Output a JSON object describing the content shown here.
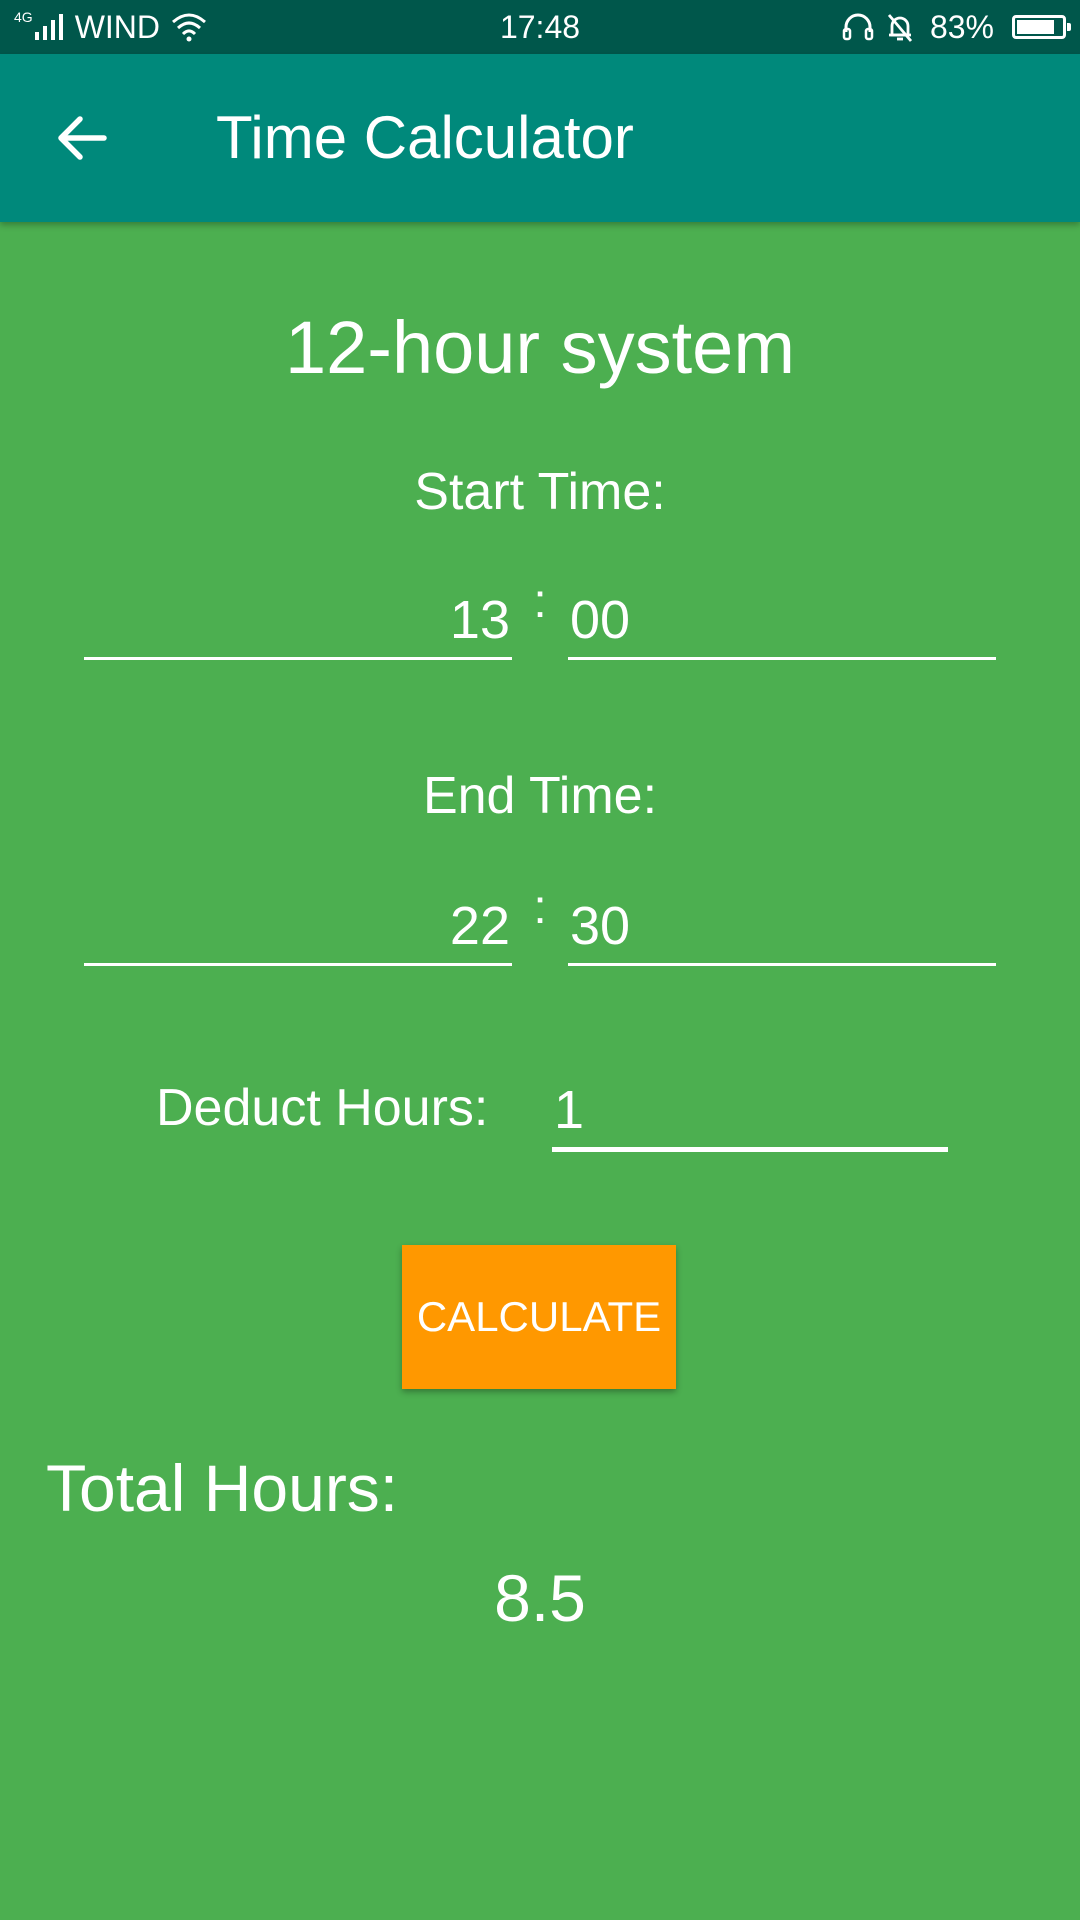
{
  "status_bar": {
    "network_type": "4G",
    "carrier": "WIND",
    "time": "17:48",
    "battery_percent": "83%",
    "battery_level": 0.83,
    "icons": [
      "signal-icon",
      "wifi-icon",
      "headset-icon",
      "bell-muted-icon",
      "battery-icon"
    ]
  },
  "app_bar": {
    "title": "Time Calculator",
    "back_icon": "arrow-left-icon",
    "background": "#00897b"
  },
  "form": {
    "heading": "12-hour system",
    "start_label": "Start Time:",
    "start_hour": "13",
    "start_minute": "00",
    "separator": ":",
    "end_label": "End Time:",
    "end_hour": "22",
    "end_minute": "30",
    "deduct_label": "Deduct Hours:",
    "deduct_value": "1",
    "calculate_label": "CALCULATE",
    "calculate_color": "#ff9800"
  },
  "result": {
    "label": "Total Hours:",
    "value": "8.5"
  },
  "colors": {
    "background": "#4caf50",
    "status_bar": "#00574b"
  }
}
